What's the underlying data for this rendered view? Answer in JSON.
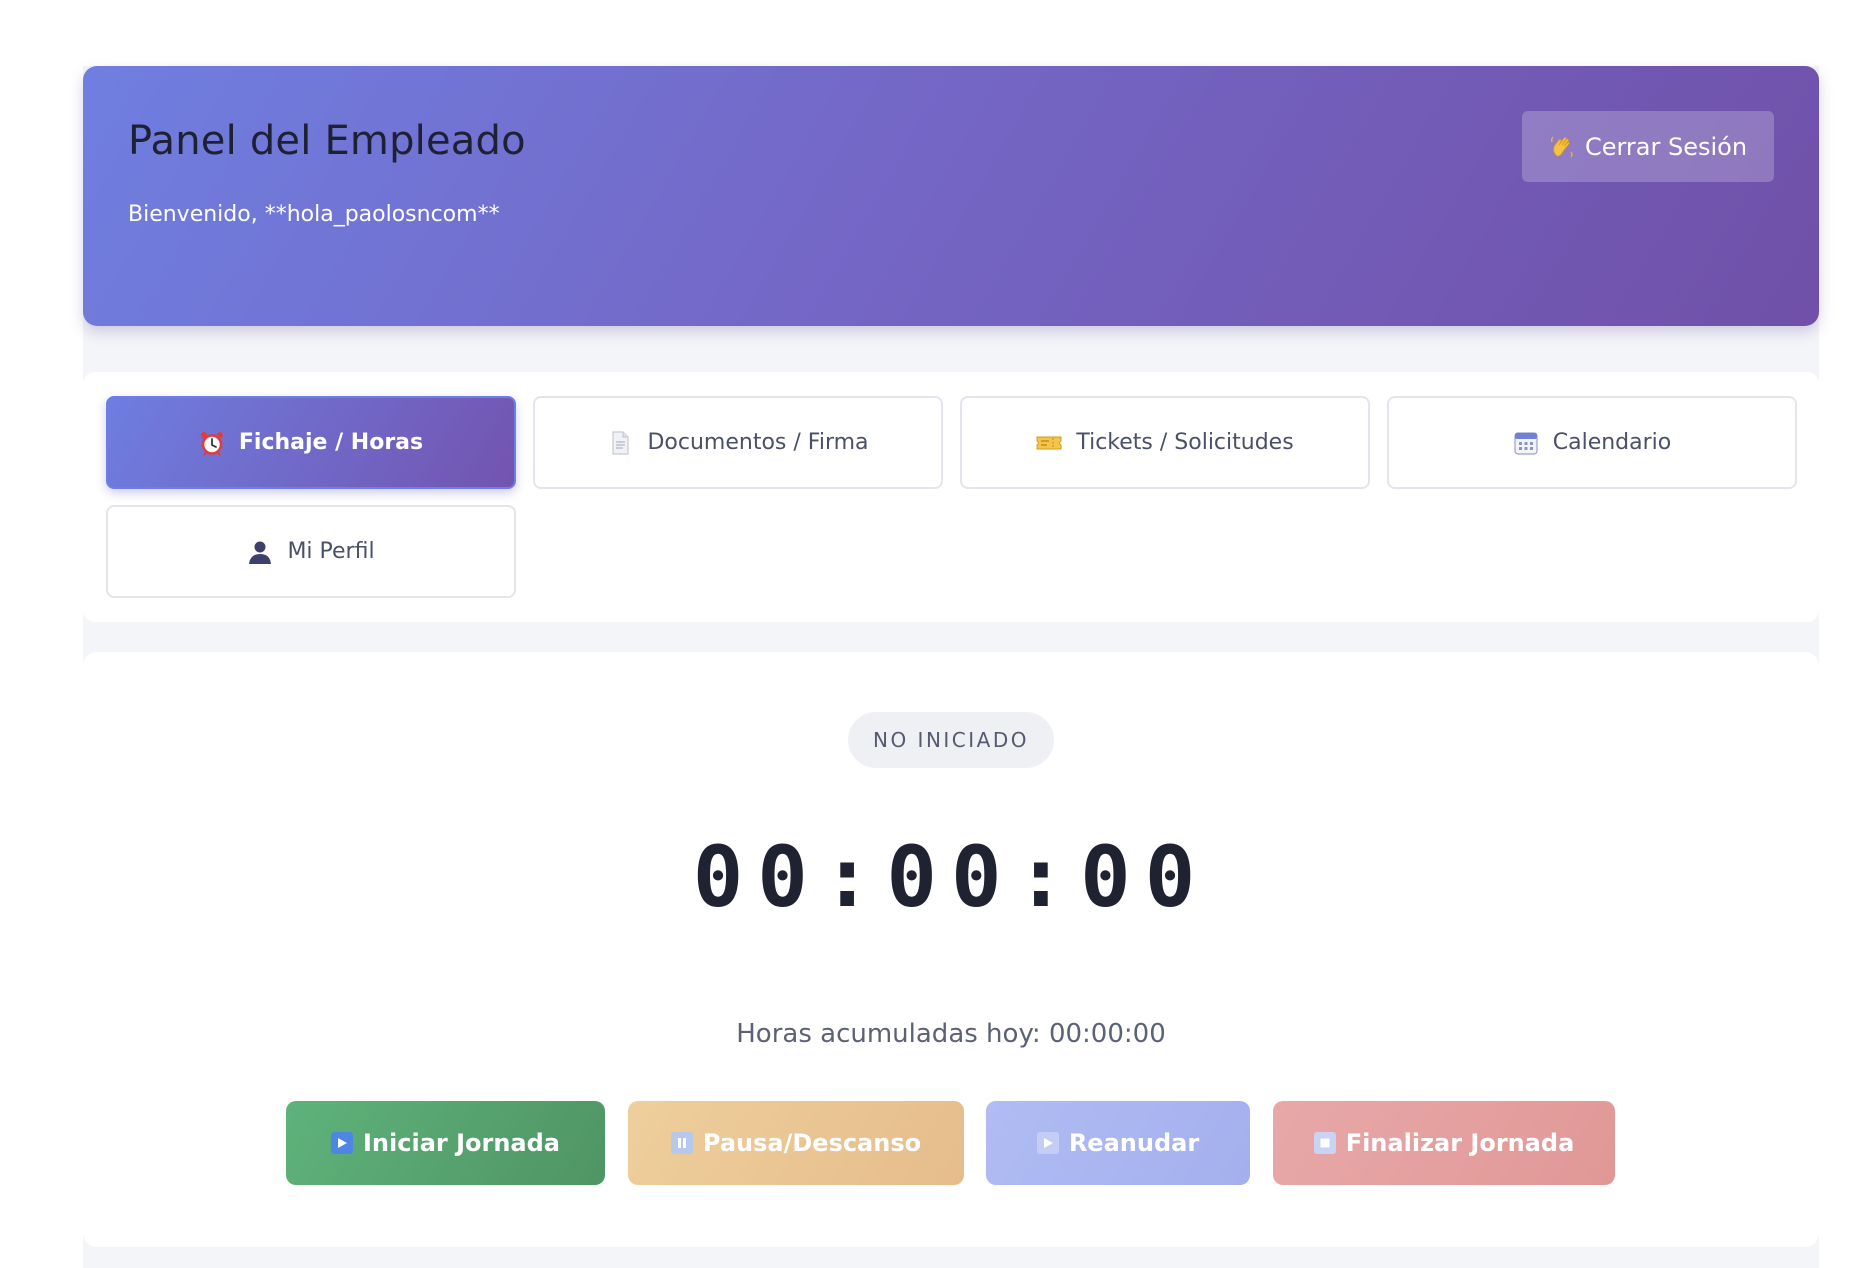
{
  "header": {
    "title": "Panel del Empleado",
    "welcome": "Bienvenido, **hola_paolosncom**",
    "logout_label": "Cerrar Sesión",
    "logout_icon": "waving-hand-icon"
  },
  "tabs": [
    {
      "label": "Fichaje / Horas",
      "icon": "alarm-clock-icon",
      "active": true
    },
    {
      "label": "Documentos / Firma",
      "icon": "document-icon",
      "active": false
    },
    {
      "label": "Tickets / Solicitudes",
      "icon": "ticket-icon",
      "active": false
    },
    {
      "label": "Calendario",
      "icon": "calendar-icon",
      "active": false
    },
    {
      "label": "Mi Perfil",
      "icon": "user-silhouette-icon",
      "active": false
    }
  ],
  "timer": {
    "status": "NO INICIADO",
    "display": "00:00:00",
    "accumulated": "Horas acumuladas hoy: 00:00:00"
  },
  "actions": {
    "start": {
      "label": "Iniciar Jornada",
      "icon": "play-icon",
      "color": "#58a46f"
    },
    "pause": {
      "label": "Pausa/Descanso",
      "icon": "pause-icon",
      "color": "#eac596"
    },
    "resume": {
      "label": "Reanudar",
      "icon": "play-icon",
      "color": "#aab6f0"
    },
    "finish": {
      "label": "Finalizar Jornada",
      "icon": "stop-icon",
      "color": "#e4a09f"
    }
  },
  "colors": {
    "header_gradient_start": "#6f7fe0",
    "header_gradient_end": "#7050a8",
    "accent": "#6c7ee8"
  }
}
